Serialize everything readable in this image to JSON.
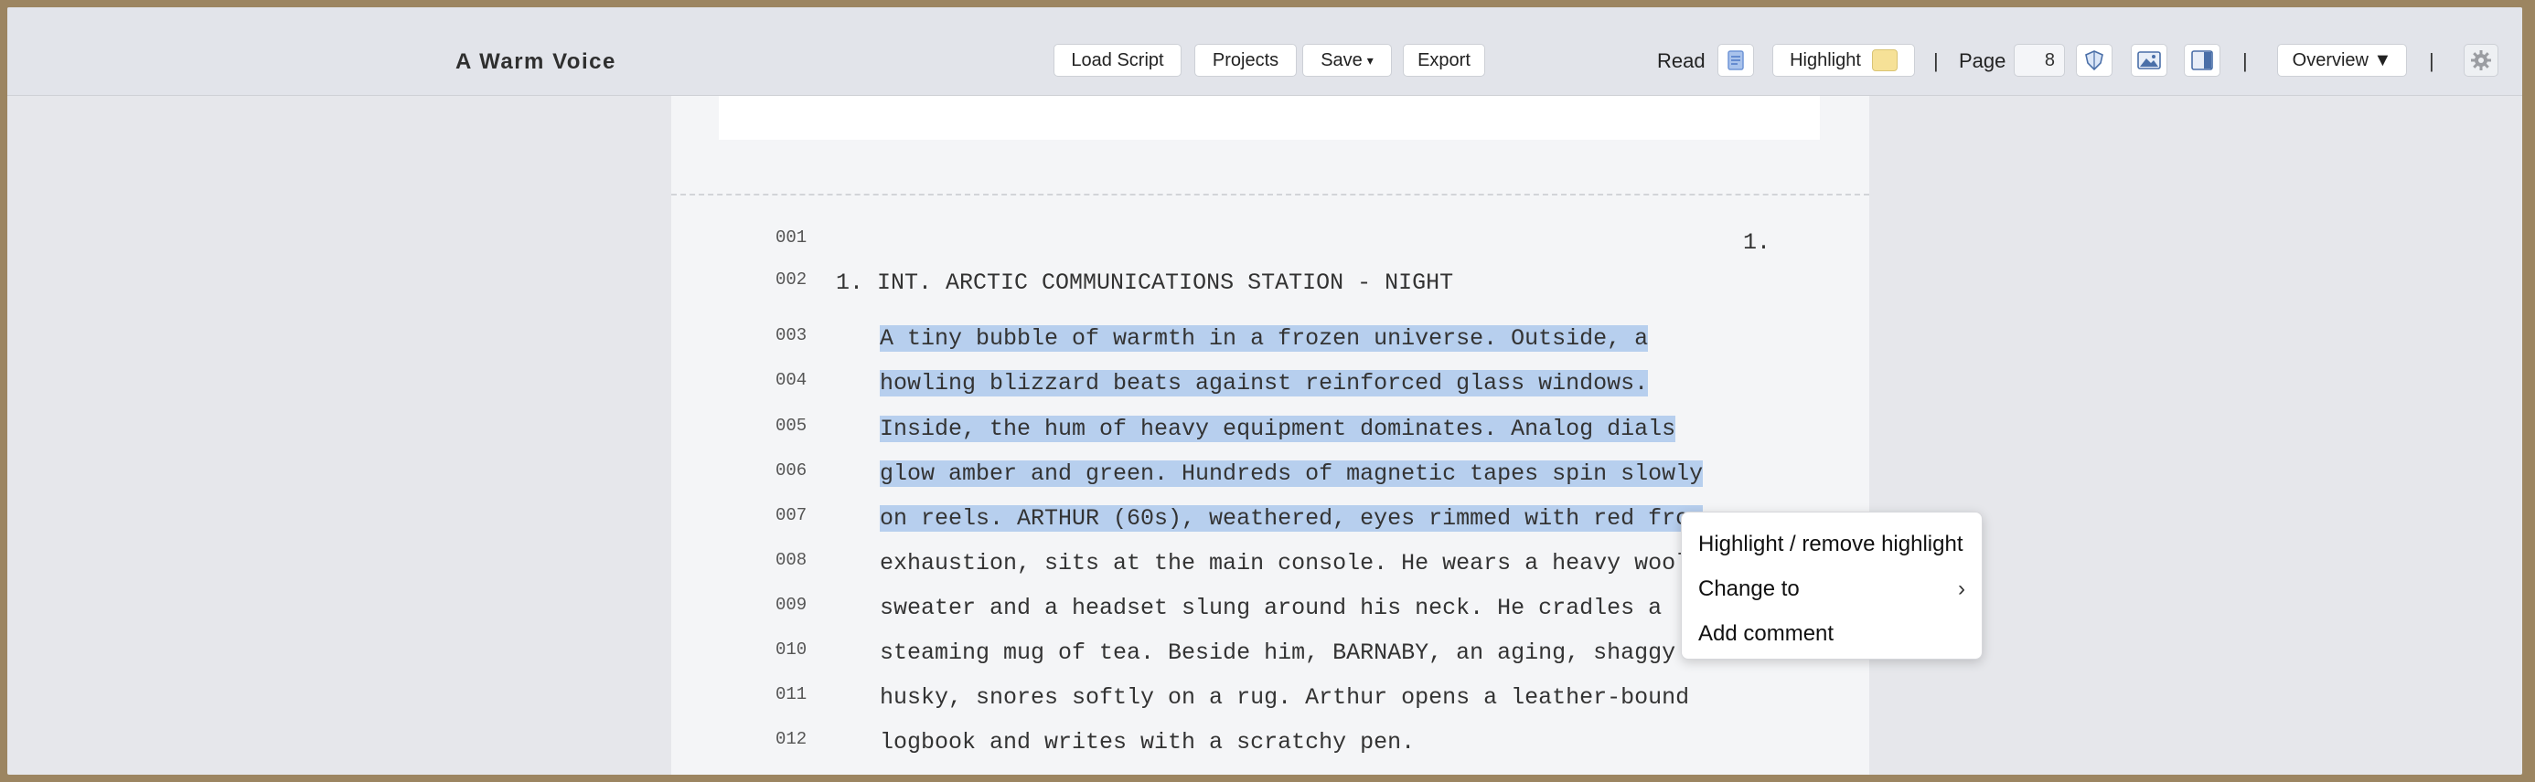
{
  "app": {
    "title": "A Warm Voice"
  },
  "toolbar": {
    "load_script": "Load Script",
    "projects": "Projects",
    "save": "Save",
    "save_caret": "▾",
    "export": "Export",
    "read_label": "Read",
    "highlight_label": "Highlight",
    "highlight_color": "#f6e197",
    "separator": "|",
    "page_label": "Page",
    "page_value": "8",
    "overview": "Overview ▼",
    "icons": [
      "document-icon",
      "shield-icon",
      "image-icon",
      "panel-icon",
      "gear-icon"
    ]
  },
  "script": {
    "page_number": "1.",
    "scene_heading": "1. INT. ARCTIC COMMUNICATIONS STATION - NIGHT",
    "lines": [
      {
        "num": "001",
        "text": ""
      },
      {
        "num": "002",
        "text": ""
      },
      {
        "num": "003",
        "text": "A tiny bubble of warmth in a frozen universe. Outside, a"
      },
      {
        "num": "004",
        "text": "howling blizzard beats against reinforced glass windows."
      },
      {
        "num": "005",
        "text": "Inside, the hum of heavy equipment dominates. Analog dials"
      },
      {
        "num": "006",
        "text": "glow amber and green. Hundreds of magnetic tapes spin slowly"
      },
      {
        "num": "007",
        "text": "on reels. ARTHUR (60s), weathered, eyes rimmed with red from"
      },
      {
        "num": "008",
        "text": "exhaustion, sits at the main console. He wears a heavy wool"
      },
      {
        "num": "009",
        "text": "sweater and a headset slung around his neck. He cradles a"
      },
      {
        "num": "010",
        "text": "steaming mug of tea. Beside him, BARNABY, an aging, shaggy"
      },
      {
        "num": "011",
        "text": "husky, snores softly on a rug. Arthur opens a leather-bound"
      },
      {
        "num": "012",
        "text": "logbook and writes with a scratchy pen."
      }
    ],
    "highlight_color": "#b7cfee"
  },
  "context_menu": {
    "items": [
      "Highlight / remove highlight",
      "Change to",
      "Add comment"
    ],
    "submenu_arrow": "›"
  }
}
